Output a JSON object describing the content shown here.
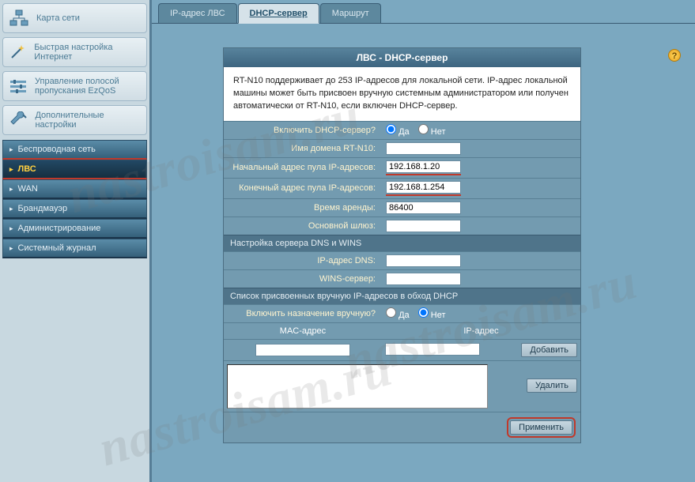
{
  "sidebar": {
    "main": [
      {
        "label": "Карта сети",
        "icon": "network"
      },
      {
        "label": "Быстрая настройка Интернет",
        "icon": "wand"
      },
      {
        "label": "Управление полосой пропускания EzQoS",
        "icon": "sliders"
      },
      {
        "label": "Дополнительные настройки",
        "icon": "wrench"
      }
    ],
    "sub": [
      {
        "label": "Беспроводная сеть"
      },
      {
        "label": "ЛВС",
        "active": true
      },
      {
        "label": "WAN"
      },
      {
        "label": "Брандмауэр"
      },
      {
        "label": "Администрирование"
      },
      {
        "label": "Системный журнал"
      }
    ]
  },
  "tabs": [
    {
      "label": "IP-адрес ЛВС"
    },
    {
      "label": "DHCP-сервер",
      "active": true
    },
    {
      "label": "Маршрут"
    }
  ],
  "panel": {
    "title": "ЛВС - DHCP-сервер",
    "desc": "RT-N10 поддерживает до 253 IP-адресов для локальной сети. IP-адрес локальной машины может быть присвоен вручную системным администратором или получен автоматически от RT-N10, если включен DHCP-сервер."
  },
  "form": {
    "enable_label": "Включить DHCP-сервер?",
    "yes": "Да",
    "no": "Нет",
    "enable_value": "yes",
    "domain_label": "Имя домена RT-N10:",
    "domain_value": "",
    "start_label": "Начальный адрес пула IP-адресов:",
    "start_value": "192.168.1.20",
    "end_label": "Конечный адрес пула IP-адресов:",
    "end_value": "192.168.1.254",
    "lease_label": "Время аренды:",
    "lease_value": "86400",
    "gateway_label": "Основной шлюз:",
    "gateway_value": ""
  },
  "dns_section": {
    "title": "Настройка сервера DNS и WINS",
    "dns_label": "IP-адрес DNS:",
    "dns_value": "",
    "wins_label": "WINS-сервер:",
    "wins_value": ""
  },
  "manual_section": {
    "title": "Список присвоенных вручную IP-адресов в обход DHCP",
    "enable_label": "Включить назначение вручную?",
    "enable_value": "no",
    "mac_header": "MAC-адрес",
    "ip_header": "IP-адрес",
    "add_btn": "Добавить",
    "del_btn": "Удалить"
  },
  "apply_btn": "Применить",
  "watermark": "nastroisam.ru"
}
